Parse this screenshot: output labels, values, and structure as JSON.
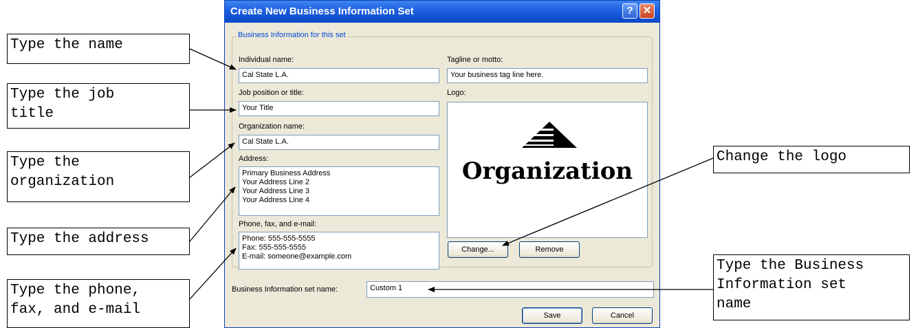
{
  "dialog": {
    "title": "Create New Business Information Set",
    "help_label": "?",
    "close_label": "✕",
    "group_title": "Business Information for this set",
    "individual_name": {
      "label": "Individual name:",
      "value": "Cal State L.A."
    },
    "job_title": {
      "label": "Job position or title:",
      "value": "Your Title"
    },
    "organization": {
      "label": "Organization name:",
      "value": "Cal State L.A."
    },
    "address": {
      "label": "Address:",
      "lines": [
        "Primary Business Address",
        "Your Address Line 2",
        "Your Address Line 3",
        "Your Address Line 4"
      ]
    },
    "contact": {
      "label": "Phone, fax, and e-mail:",
      "lines": [
        "Phone: 555-555-5555",
        "Fax: 555-555-5555",
        "E-mail: someone@example.com"
      ]
    },
    "tagline": {
      "label": "Tagline or motto:",
      "value": "Your business tag line here."
    },
    "logo": {
      "label": "Logo:",
      "text": "Organization"
    },
    "change_button": "Change...",
    "remove_button": "Remove",
    "set_name": {
      "label": "Business Information set name:",
      "value": "Custom 1"
    },
    "save_button": "Save",
    "cancel_button": "Cancel"
  },
  "callouts": {
    "name": "Type the name",
    "job_title": "Type the job\ntitle",
    "organization": "Type the\norganization",
    "address": "Type the address",
    "contact": "Type the phone,\nfax, and e-mail",
    "logo": "Change the logo",
    "set_name": "Type the Business\nInformation set\nname"
  }
}
